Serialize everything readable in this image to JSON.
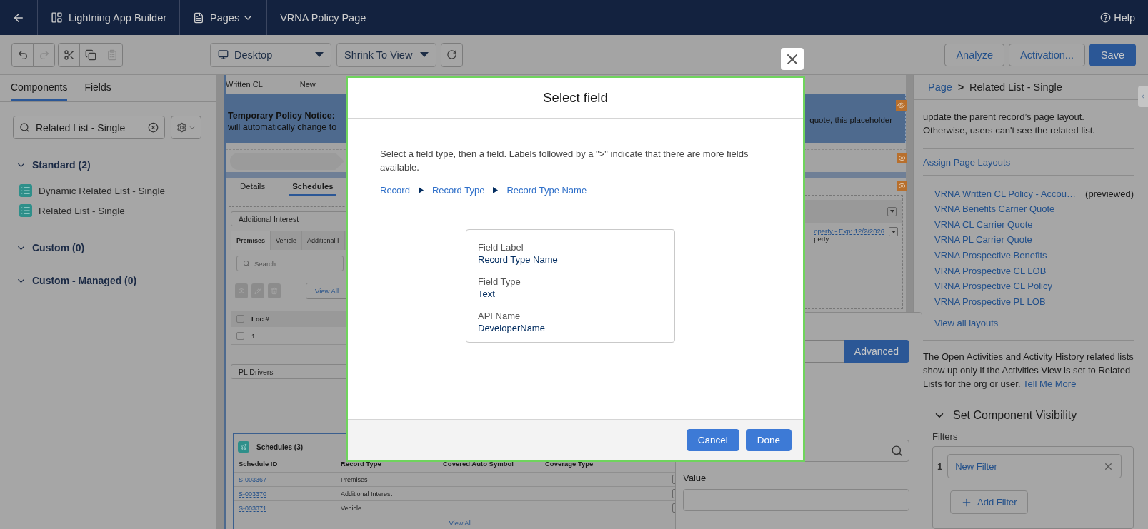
{
  "nav": {
    "app_title": "Lightning App Builder",
    "pages_menu": "Pages",
    "page_name": "VRNA Policy Page",
    "help": "Help"
  },
  "toolbar": {
    "history": [
      {
        "kind": "undo",
        "disabled": false
      },
      {
        "kind": "redo",
        "disabled": true
      }
    ],
    "clipboard": [
      {
        "kind": "cut",
        "disabled": false
      },
      {
        "kind": "copy",
        "disabled": false
      },
      {
        "kind": "paste",
        "disabled": true
      }
    ],
    "device": "Desktop",
    "zoom": "Shrink To View",
    "actions": [
      "Analyze",
      "Activation..."
    ],
    "save": "Save"
  },
  "left_panel": {
    "tabs": [
      {
        "label": "Components",
        "selected": true
      },
      {
        "label": "Fields",
        "selected": false
      }
    ],
    "search": {
      "value": "Related List - Single"
    },
    "groups": [
      {
        "label": "Standard (2)",
        "expanded": true,
        "items": [
          "Dynamic Related List - Single",
          "Related List - Single"
        ]
      },
      {
        "label": "Custom (0)",
        "expanded": true
      },
      {
        "label": "Custom - Managed (0)",
        "expanded": true
      }
    ]
  },
  "canvas": {
    "highlights": [
      "Written CL",
      "New"
    ],
    "notice": {
      "title": "Temporary Policy Notice:",
      "line": "will automatically change to",
      "tail": "quote, this placeholder"
    },
    "tabs": [
      {
        "label": "Details",
        "selected": false
      },
      {
        "label": "Schedules",
        "selected": true
      }
    ],
    "sections": [
      "Additional Interest",
      "PL Drivers"
    ],
    "subtabs": [
      {
        "label": "Premises",
        "selected": true
      },
      {
        "label": "Vehicle",
        "selected": false
      },
      {
        "label": "Additional I",
        "selected": false
      }
    ],
    "search_placeholder": "Search",
    "view_all": "View All",
    "table": {
      "column": "Loc #",
      "rows": [
        "1"
      ]
    },
    "related_list": {
      "title": "Schedules (3)",
      "columns": [
        "Schedule ID",
        "Record Type",
        "Covered Auto Symbol",
        "Coverage Type"
      ],
      "rows": [
        {
          "id": "S-003367",
          "record_type": "Premises"
        },
        {
          "id": "S-003370",
          "record_type": "Additional Interest"
        },
        {
          "id": "S-003371",
          "record_type": "Vehicle"
        }
      ],
      "footer": "View All"
    },
    "side_card": {
      "link": "operty - Exp: 12/2/2026",
      "detail": "perty"
    }
  },
  "modal": {
    "title": "Select field",
    "description": "Select a field type, then a field. Labels followed by a \">\" indicate that there are more fields available.",
    "path": [
      "Record",
      "Record Type",
      "Record Type Name"
    ],
    "details": [
      {
        "label": "Field Label",
        "value": "Record Type Name"
      },
      {
        "label": "Field Type",
        "value": "Text"
      },
      {
        "label": "API Name",
        "value": "DeveloperName"
      }
    ],
    "buttons": [
      "Cancel",
      "Done"
    ]
  },
  "right_panel": {
    "breadcrumb": {
      "root": "Page",
      "separator": ">",
      "current": "Related List - Single"
    },
    "note_lines": [
      "update the parent record’s page layout.",
      "Otherwise, users can't see the related list."
    ],
    "assign_link": "Assign Page Layouts",
    "layouts": [
      {
        "name": "VRNA Written CL Policy - Accou…",
        "note": "(previewed)"
      },
      {
        "name": "VRNA Benefits Carrier Quote"
      },
      {
        "name": "VRNA CL Carrier Quote"
      },
      {
        "name": "VRNA PL Carrier Quote"
      },
      {
        "name": "VRNA Prospective Benefits"
      },
      {
        "name": "VRNA Prospective CL LOB"
      },
      {
        "name": "VRNA Prospective CL Policy"
      },
      {
        "name": "VRNA Prospective PL LOB"
      }
    ],
    "view_all": "View all layouts",
    "activities_note": "The Open Activities and Activity History related lists show up only if the Activities View is set to Related Lists for the org or user.",
    "tell_me_more": "Tell Me More",
    "visibility": {
      "title": "Set Component Visibility",
      "expanded": true,
      "filters_label": "Filters",
      "filters": [
        {
          "index": "1",
          "label": "New Filter"
        }
      ],
      "add": "Add Filter"
    }
  },
  "filter_popover": {
    "modes": [
      {
        "label": "Advanced",
        "selected": true
      }
    ],
    "value_label": "Value"
  }
}
